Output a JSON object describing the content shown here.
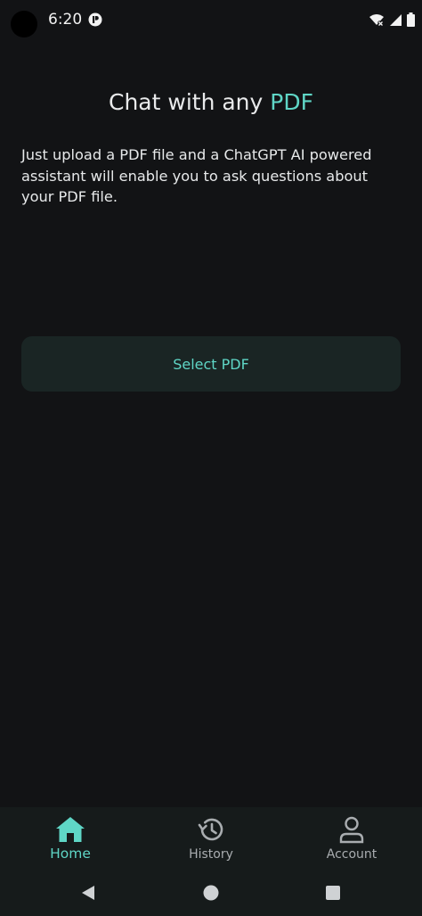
{
  "status_bar": {
    "time": "6:20"
  },
  "main": {
    "title_prefix": "Chat with any ",
    "title_accent": "PDF",
    "intro": "Just upload a PDF file and a ChatGPT AI powered assistant will enable you to ask questions about your PDF file.",
    "select_button_label": "Select PDF"
  },
  "bottom_nav": {
    "items": [
      {
        "label": "Home",
        "icon": "home-icon",
        "active": true
      },
      {
        "label": "History",
        "icon": "history-icon",
        "active": false
      },
      {
        "label": "Account",
        "icon": "account-icon",
        "active": false
      }
    ]
  },
  "colors": {
    "background": "#121315",
    "accent": "#5fd6c6",
    "button_bg": "#1a2524",
    "nav_bg": "#161b1b",
    "inactive_label": "#a9adb0"
  }
}
